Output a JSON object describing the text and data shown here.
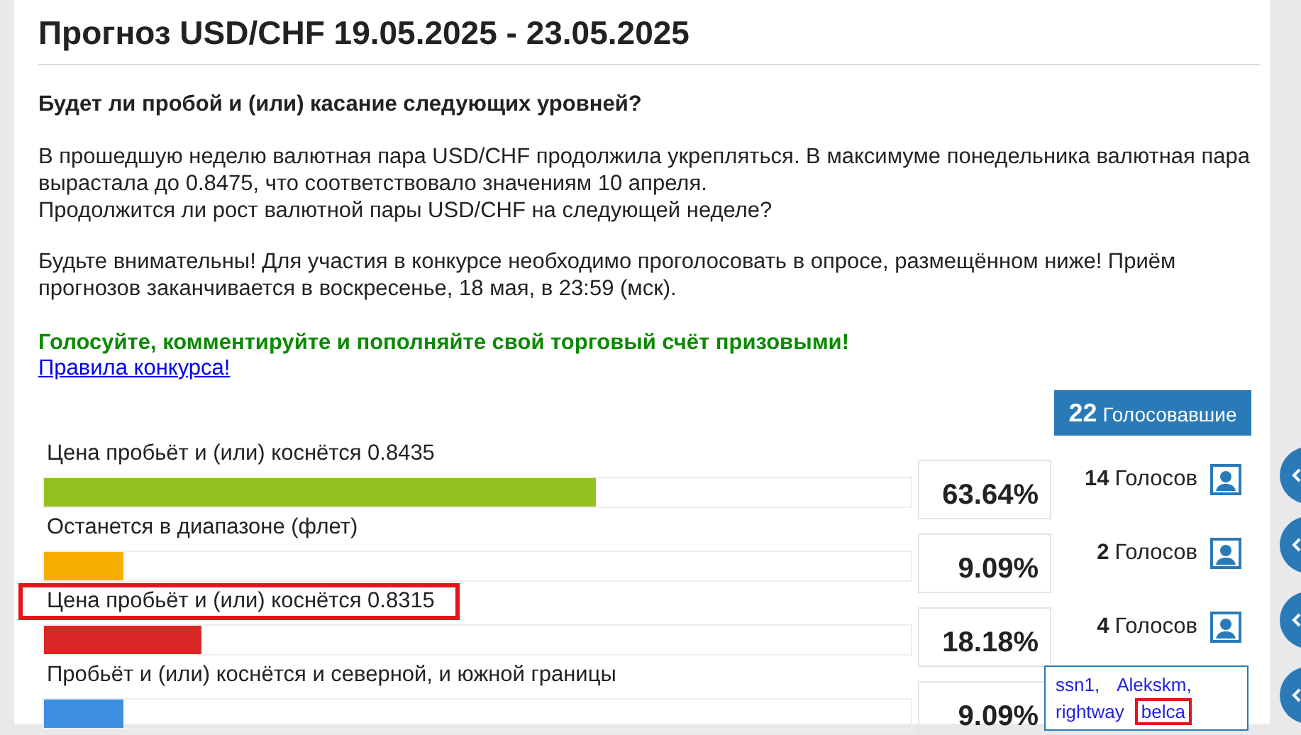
{
  "title": "Прогноз USD/CHF 19.05.2025 - 23.05.2025",
  "question": "Будет ли пробой и (или) касание следующих уровней?",
  "paragraphs": [
    [
      "В прошедшую неделю валютная пара USD/CHF продолжила укрепляться. В максимуме понедельника валютная пара вырастала до 0.8475, что соответствовало значениям 10 апреля.",
      "Продолжится ли рост валютной пары USD/CHF на следующей неделе?"
    ],
    [
      "Будьте внимательны! Для участия в конкурсе необходимо проголосовать в опросе, размещённом ниже! Приём прогнозов заканчивается в воскресенье, 18 мая, в 23:59 (мск)."
    ]
  ],
  "call_to_action": "Голосуйте, комментируйте и пополняйте свой торговый счёт призовыми!",
  "rules_link": "Правила конкурса!",
  "poll": {
    "voters_count": "22",
    "voters_label": "Голосовавшие",
    "options": [
      {
        "label": "Цена пробьёт и (или) коснётся 0.8435",
        "level": 0.6364,
        "percent": "63.64%",
        "votes_count": "14",
        "votes_label": "Голосов",
        "color": "#94c11f",
        "highlighted": false
      },
      {
        "label": "Останется в диапазоне (флет)",
        "level": 0.0909,
        "percent": "9.09%",
        "votes_count": "2",
        "votes_label": "Голосов",
        "color": "#f7ad00",
        "highlighted": false
      },
      {
        "label": "Цена пробьёт и (или) коснётся 0.8315",
        "level": 0.1818,
        "percent": "18.18%",
        "votes_count": "4",
        "votes_label": "Голосов",
        "color": "#d92726",
        "highlighted": true,
        "voters": [
          {
            "name": "ssn1,",
            "highlighted": false
          },
          {
            "name": "Alekskm,",
            "highlighted": false
          },
          {
            "name": "rightway",
            "highlighted": false
          },
          {
            "name": "belca",
            "highlighted": true
          }
        ]
      },
      {
        "label": "Пробьёт и (или) коснётся и северной, и южной границы",
        "level": 0.0909,
        "percent": "9.09%",
        "color": "#3d8fe0",
        "highlighted": false
      }
    ]
  }
}
